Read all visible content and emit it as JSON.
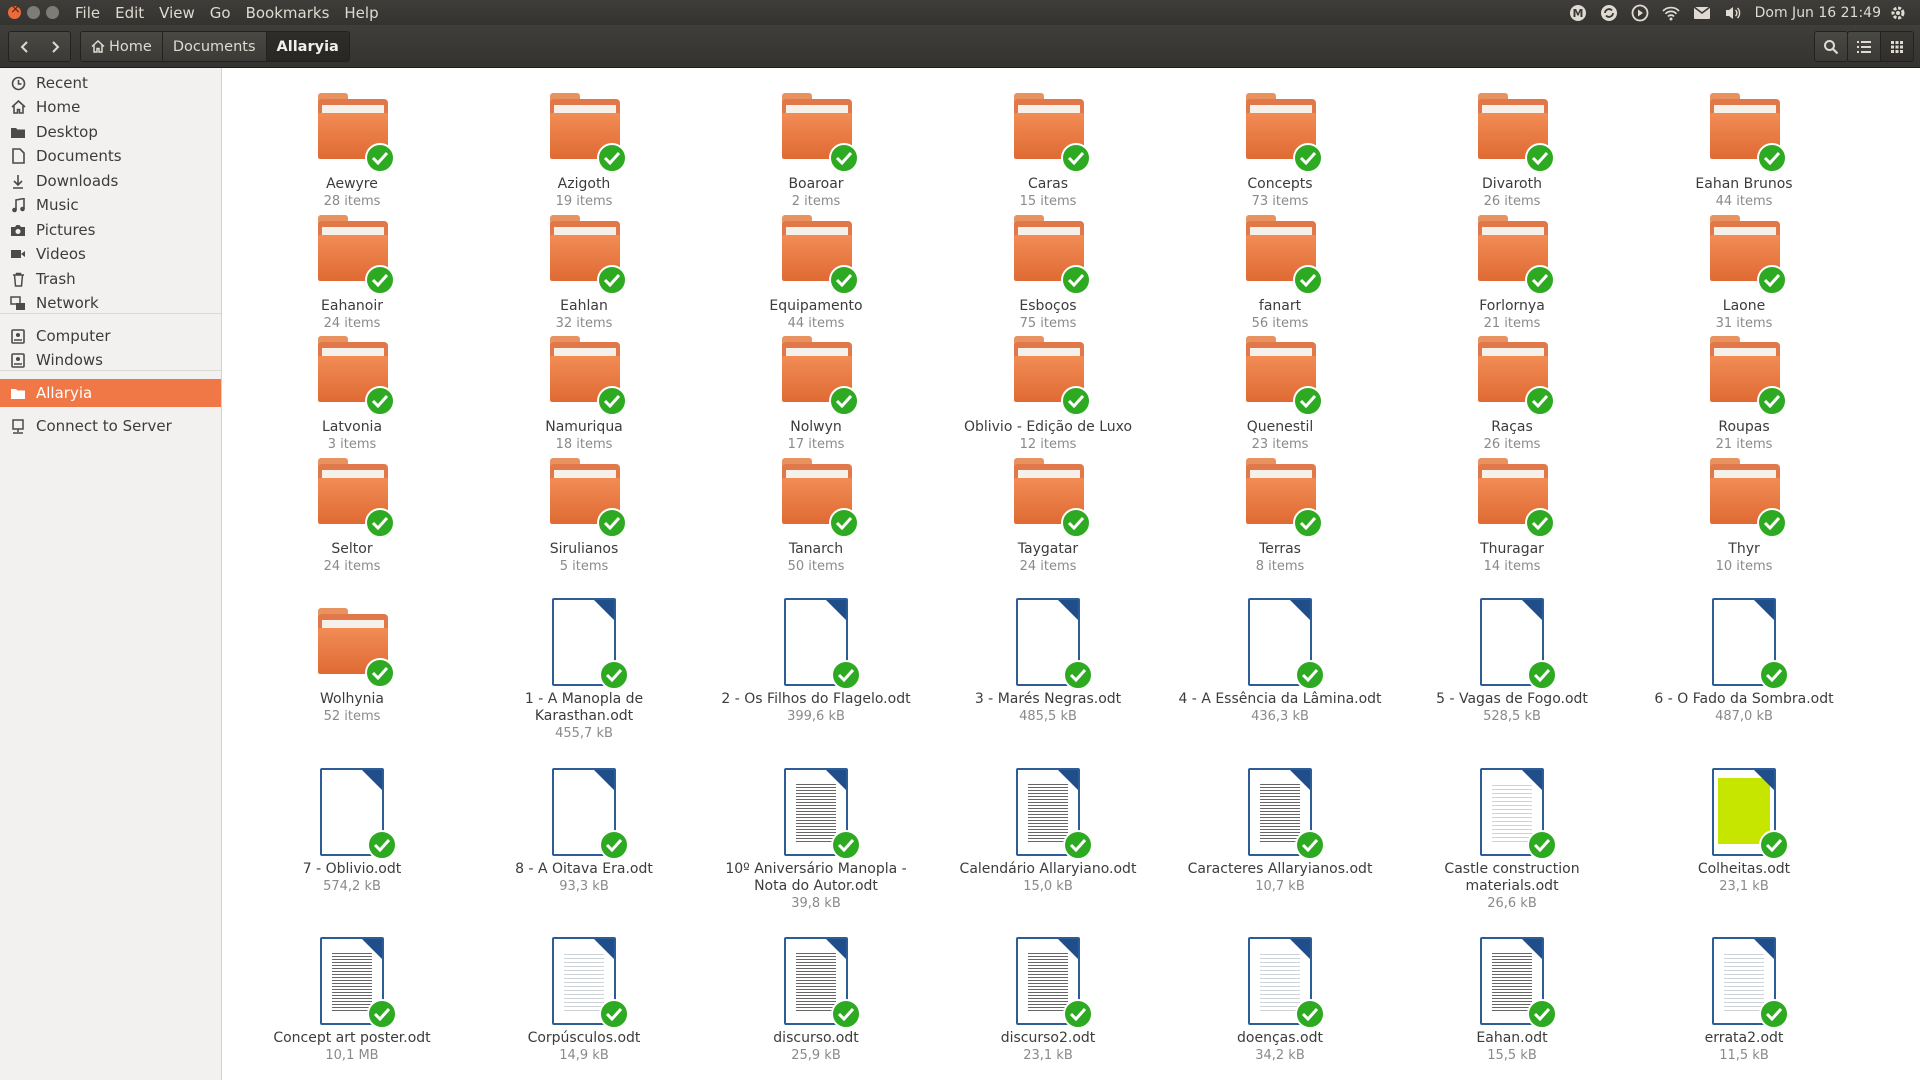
{
  "menubar": {
    "menus": [
      "File",
      "Edit",
      "View",
      "Go",
      "Bookmarks",
      "Help"
    ],
    "clock": "Dom Jun 16 21:49",
    "indicators": [
      "mega-icon",
      "sync-icon",
      "media-player-icon",
      "wifi-icon",
      "mail-icon",
      "volume-icon",
      "power-gear-icon"
    ]
  },
  "toolbar": {
    "breadcrumbs": [
      "Home",
      "Documents",
      "Allaryia"
    ],
    "active_crumb": "Allaryia"
  },
  "sidebar": {
    "items": [
      {
        "label": "Recent",
        "icon": "clock-icon"
      },
      {
        "label": "Home",
        "icon": "home-icon"
      },
      {
        "label": "Desktop",
        "icon": "desktop-folder-icon"
      },
      {
        "label": "Documents",
        "icon": "document-icon"
      },
      {
        "label": "Downloads",
        "icon": "download-icon"
      },
      {
        "label": "Music",
        "icon": "music-icon"
      },
      {
        "label": "Pictures",
        "icon": "camera-icon"
      },
      {
        "label": "Videos",
        "icon": "video-icon"
      },
      {
        "label": "Trash",
        "icon": "trash-icon"
      },
      {
        "label": "Network",
        "icon": "network-icon"
      },
      {
        "label": "Computer",
        "icon": "drive-icon"
      },
      {
        "label": "Windows",
        "icon": "drive-icon"
      },
      {
        "label": "Allaryia",
        "icon": "folder-icon",
        "active": true
      },
      {
        "label": "Connect to Server",
        "icon": "server-icon"
      }
    ]
  },
  "files": [
    {
      "name": "Aewyre",
      "meta": "28 items",
      "type": "folder"
    },
    {
      "name": "Azigoth",
      "meta": "19 items",
      "type": "folder"
    },
    {
      "name": "Boaroar",
      "meta": "2 items",
      "type": "folder"
    },
    {
      "name": "Caras",
      "meta": "15 items",
      "type": "folder"
    },
    {
      "name": "Concepts",
      "meta": "73 items",
      "type": "folder"
    },
    {
      "name": "Divaroth",
      "meta": "26 items",
      "type": "folder"
    },
    {
      "name": "Eahan Brunos",
      "meta": "44 items",
      "type": "folder"
    },
    {
      "name": "Eahanoir",
      "meta": "24 items",
      "type": "folder"
    },
    {
      "name": "Eahlan",
      "meta": "32 items",
      "type": "folder"
    },
    {
      "name": "Equipamento",
      "meta": "44 items",
      "type": "folder"
    },
    {
      "name": "Esboços",
      "meta": "75 items",
      "type": "folder"
    },
    {
      "name": "fanart",
      "meta": "56 items",
      "type": "folder"
    },
    {
      "name": "Forlornya",
      "meta": "21 items",
      "type": "folder"
    },
    {
      "name": "Laone",
      "meta": "31 items",
      "type": "folder"
    },
    {
      "name": "Latvonia",
      "meta": "3 items",
      "type": "folder"
    },
    {
      "name": "Namuriqua",
      "meta": "18 items",
      "type": "folder"
    },
    {
      "name": "Nolwyn",
      "meta": "17 items",
      "type": "folder"
    },
    {
      "name": "Oblivio - Edição de Luxo",
      "meta": "12 items",
      "type": "folder"
    },
    {
      "name": "Quenestil",
      "meta": "23 items",
      "type": "folder"
    },
    {
      "name": "Raças",
      "meta": "26 items",
      "type": "folder"
    },
    {
      "name": "Roupas",
      "meta": "21 items",
      "type": "folder"
    },
    {
      "name": "Seltor",
      "meta": "24 items",
      "type": "folder"
    },
    {
      "name": "Sirulianos",
      "meta": "5 items",
      "type": "folder"
    },
    {
      "name": "Tanarch",
      "meta": "50 items",
      "type": "folder"
    },
    {
      "name": "Taygatar",
      "meta": "24 items",
      "type": "folder"
    },
    {
      "name": "Terras",
      "meta": "8 items",
      "type": "folder"
    },
    {
      "name": "Thuragar",
      "meta": "14 items",
      "type": "folder"
    },
    {
      "name": "Thyr",
      "meta": "10 items",
      "type": "folder"
    },
    {
      "name": "Wolhynia",
      "meta": "52 items",
      "type": "folder"
    },
    {
      "name": "1 - A Manopla de Karasthan.odt",
      "meta": "455,7 kB",
      "type": "doc"
    },
    {
      "name": "2 - Os Filhos do Flagelo.odt",
      "meta": "399,6 kB",
      "type": "doc"
    },
    {
      "name": "3 - Marés Negras.odt",
      "meta": "485,5 kB",
      "type": "doc"
    },
    {
      "name": "4 - A Essência da Lâmina.odt",
      "meta": "436,3 kB",
      "type": "doc"
    },
    {
      "name": "5 - Vagas de Fogo.odt",
      "meta": "528,5 kB",
      "type": "doc"
    },
    {
      "name": "6 - O Fado da Sombra.odt",
      "meta": "487,0 kB",
      "type": "doc"
    },
    {
      "name": "7 - Oblivio.odt",
      "meta": "574,2 kB",
      "type": "doc"
    },
    {
      "name": "8 - A Oitava Era.odt",
      "meta": "93,3 kB",
      "type": "doc"
    },
    {
      "name": "10º Aniversário Manopla - Nota do Autor.odt",
      "meta": "39,8 kB",
      "type": "doc",
      "thumb": "dense"
    },
    {
      "name": "Calendário Allaryiano.odt",
      "meta": "15,0 kB",
      "type": "doc",
      "thumb": "dense"
    },
    {
      "name": "Caracteres Allaryianos.odt",
      "meta": "10,7 kB",
      "type": "doc",
      "thumb": "dense"
    },
    {
      "name": "Castle construction materials.odt",
      "meta": "26,6 kB",
      "type": "doc",
      "thumb": "light"
    },
    {
      "name": "Colheitas.odt",
      "meta": "23,1 kB",
      "type": "doc",
      "thumb": "green"
    },
    {
      "name": "Concept art poster.odt",
      "meta": "10,1 MB",
      "type": "doc",
      "thumb": "dense"
    },
    {
      "name": "Corpúsculos.odt",
      "meta": "14,9 kB",
      "type": "doc",
      "thumb": "light"
    },
    {
      "name": "discurso.odt",
      "meta": "25,9 kB",
      "type": "doc",
      "thumb": "dense"
    },
    {
      "name": "discurso2.odt",
      "meta": "23,1 kB",
      "type": "doc",
      "thumb": "dense"
    },
    {
      "name": "doenças.odt",
      "meta": "34,2 kB",
      "type": "doc",
      "thumb": "light"
    },
    {
      "name": "Eahan.odt",
      "meta": "15,5 kB",
      "type": "doc",
      "thumb": "dense"
    },
    {
      "name": "errata2.odt",
      "meta": "11,5 kB",
      "type": "doc",
      "thumb": "light"
    }
  ],
  "colors": {
    "accent": "#f07746",
    "folder": "#e0784a",
    "badge": "#2eaa22",
    "doc_border": "#2c5d96"
  }
}
